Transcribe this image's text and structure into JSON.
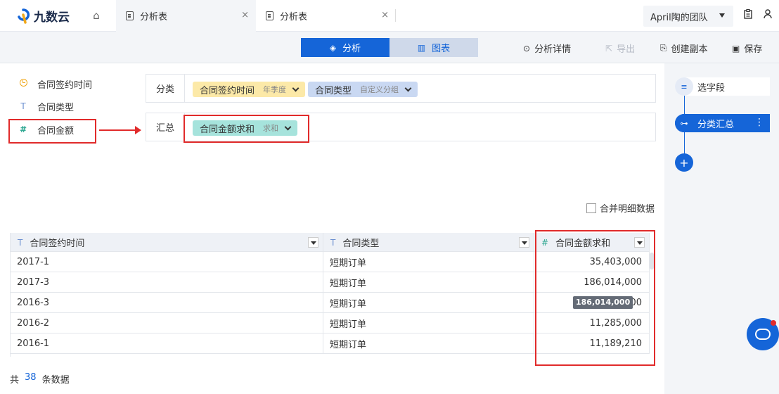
{
  "app": {
    "logo_text": "九数云",
    "tabs": [
      {
        "label": "分析表",
        "active": true
      },
      {
        "label": "分析表",
        "active": false
      }
    ],
    "team": "April陶的团队"
  },
  "toolbar": {
    "analysis_label": "分析",
    "chart_label": "图表",
    "details_label": "分析详情",
    "export_label": "导出",
    "copy_label": "创建副本",
    "save_label": "保存"
  },
  "fields": [
    {
      "label": "合同签约时间",
      "type": "date"
    },
    {
      "label": "合同类型",
      "type": "text"
    },
    {
      "label": "合同金额",
      "type": "number"
    }
  ],
  "config": {
    "group_label": "分类",
    "summary_label": "汇总",
    "group_pills": [
      {
        "label": "合同签约时间",
        "sub": "年季度"
      },
      {
        "label": "合同类型",
        "sub": "自定义分组"
      }
    ],
    "summary_pills": [
      {
        "label": "合同金额求和",
        "sub": "求和"
      }
    ],
    "merge_label": "合并明细数据"
  },
  "table": {
    "type_icons": {
      "text": "T",
      "number": "#"
    },
    "columns": [
      "合同签约时间",
      "合同类型",
      "合同金额求和"
    ],
    "rows": [
      [
        "2017-1",
        "短期订单",
        "35,403,000"
      ],
      [
        "2017-3",
        "短期订单",
        "186,014,000"
      ],
      [
        "2016-3",
        "短期订单",
        "2,000"
      ],
      [
        "2016-2",
        "短期订单",
        "11,285,000"
      ],
      [
        "2016-1",
        "短期订单",
        "11,189,210"
      ]
    ],
    "tooltip": "186,014,000",
    "footer_prefix": "共",
    "footer_count": "38",
    "footer_suffix": "条数据"
  },
  "steps": {
    "items": [
      {
        "label": "选字段"
      },
      {
        "label": "分类汇总"
      }
    ]
  },
  "colors": {
    "primary": "#1565d8",
    "annotation_red": "#e12b2b",
    "date_pill": "#fce9a8",
    "text_pill": "#c9d8f2",
    "number_pill": "#a6e3dc"
  }
}
